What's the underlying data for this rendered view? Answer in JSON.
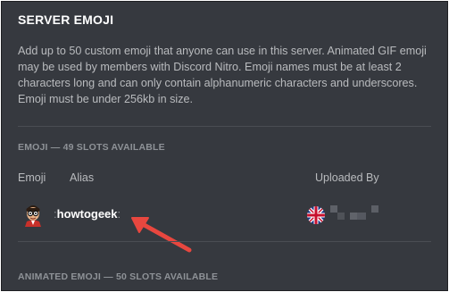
{
  "section": {
    "title": "SERVER EMOJI",
    "description": "Add up to 50 custom emoji that anyone can use in this server. Animated GIF emoji may be used by members with Discord Nitro. Emoji names must be at least 2 characters long and can only contain alphanumeric characters and underscores. Emoji must be under 256kb in size."
  },
  "emoji_list": {
    "header": "EMOJI — 49 SLOTS AVAILABLE",
    "columns": {
      "emoji": "Emoji",
      "alias": "Alias",
      "uploaded_by": "Uploaded By"
    },
    "rows": [
      {
        "alias": "howtogeek",
        "alias_prefix": ":",
        "alias_suffix": ":",
        "emoji_icon": "nerd-face-emoji",
        "uploader_icon": "union-jack-avatar"
      }
    ]
  },
  "animated_list": {
    "header": "ANIMATED EMOJI — 50 SLOTS AVAILABLE"
  },
  "annotation": {
    "icon": "red-arrow",
    "color": "#e8473f"
  },
  "colors": {
    "background": "#36393f",
    "title": "#ffffff",
    "body_text": "#b9bbbe",
    "muted": "#8e9297"
  }
}
